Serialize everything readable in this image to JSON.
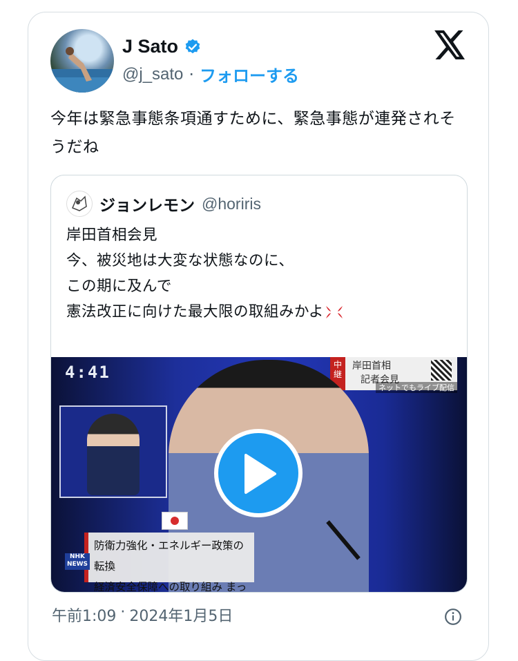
{
  "author": {
    "name": "J Sato",
    "handle": "@j_sato",
    "separator": "·",
    "follow_label": "フォローする",
    "verified": true
  },
  "brand_icon": "x-logo-icon",
  "tweet_text": "今年は緊急事態条項通すために、緊急事態が連発されそうだね",
  "quoted": {
    "name": "ジョンレモン",
    "handle": "@horiris",
    "lines": [
      "岸田首相会見",
      "今、被災地は大変な状態なのに、",
      "この期に及んで",
      "憲法改正に向けた最大限の取組みかよ"
    ],
    "emoji": "anger-symbol-icon",
    "media": {
      "timecode": "4:41",
      "caption_badge": "中継",
      "caption_title": "岸田首相",
      "caption_sub": "記者会見",
      "caption_live": "ネットでもライブ配信",
      "lower_third_line1": "防衛力強化・エネルギー政策の転換",
      "lower_third_line2": "経済安全保障への取り組み まったなし",
      "channel": "NHK NEWS"
    }
  },
  "timestamp": {
    "time": "午前1:09",
    "separator": "·",
    "date": "2024年1月5日"
  },
  "colors": {
    "accent": "#1d9bf0",
    "text": "#0f1419",
    "muted": "#536471",
    "border": "#cfd9de"
  }
}
